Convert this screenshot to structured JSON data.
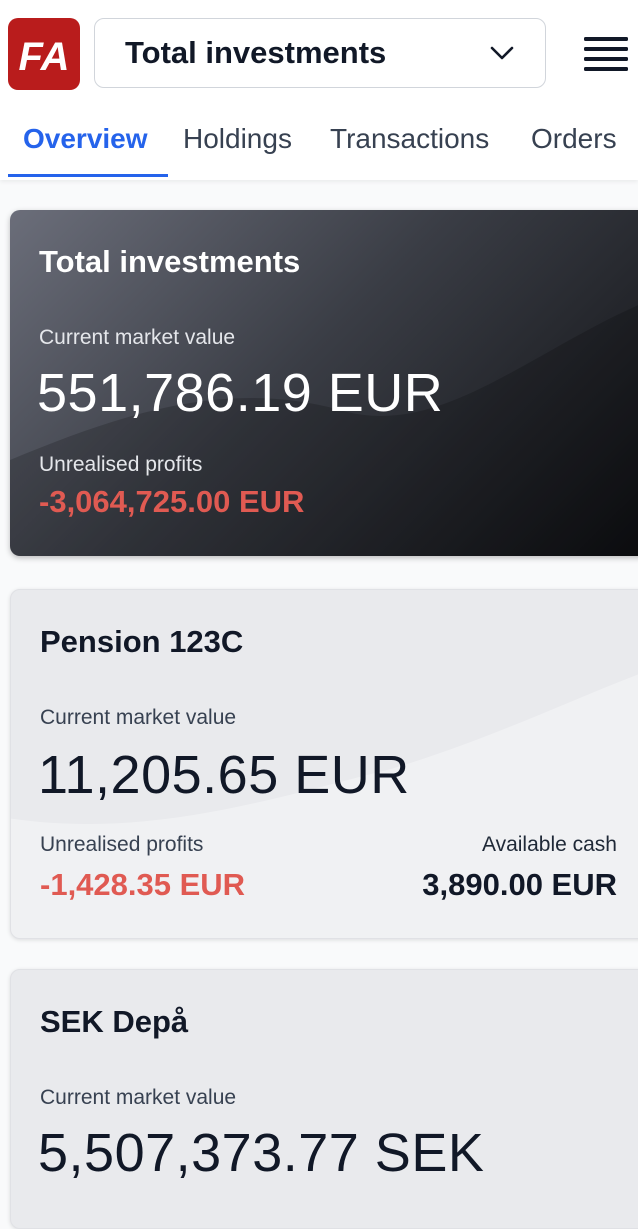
{
  "header": {
    "logo_text": "FA",
    "selector_label": "Total investments"
  },
  "tabs": [
    {
      "label": "Overview",
      "active": true
    },
    {
      "label": "Holdings",
      "active": false
    },
    {
      "label": "Transactions",
      "active": false
    },
    {
      "label": "Orders",
      "active": false
    }
  ],
  "cards": [
    {
      "title": "Total investments",
      "market_value_label": "Current market value",
      "market_value": "551,786.19 EUR",
      "profits_label": "Unrealised profits",
      "profits": "-3,064,725.00 EUR"
    },
    {
      "title": "Pension 123C",
      "market_value_label": "Current market value",
      "market_value": "11,205.65 EUR",
      "profits_label": "Unrealised profits",
      "profits": "-1,428.35 EUR",
      "cash_label": "Available cash",
      "cash": "3,890.00 EUR"
    },
    {
      "title": "SEK Depå",
      "market_value_label": "Current market value",
      "market_value": "5,507,373.77 SEK"
    }
  ],
  "colors": {
    "accent": "#2563eb",
    "brand": "#b91c1c",
    "negative": "#e05a52"
  },
  "icons": {
    "logo": "fa-logo",
    "selector": "chevron-down-icon",
    "menu": "hamburger-menu-icon"
  }
}
